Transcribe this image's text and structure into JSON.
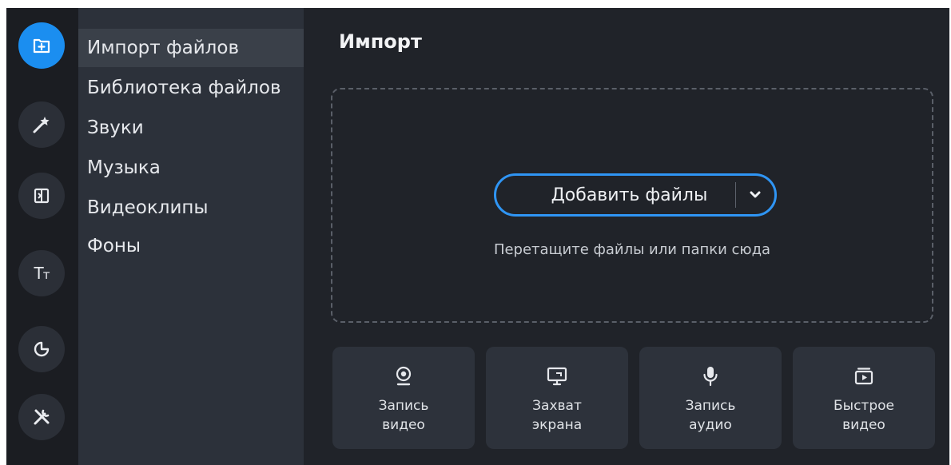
{
  "rail": {
    "items": [
      {
        "icon": "add-files-icon",
        "active": true
      },
      {
        "icon": "magic-wand-icon",
        "active": false
      },
      {
        "icon": "transitions-icon",
        "active": false
      },
      {
        "icon": "titles-icon",
        "glyph_big": "T",
        "glyph_small": "т",
        "active": false
      },
      {
        "icon": "stickers-icon",
        "active": false
      },
      {
        "icon": "tools-icon",
        "active": false
      }
    ],
    "accent_color": "#1b8ef0"
  },
  "categories": {
    "items": [
      {
        "label": "Импорт файлов",
        "active": true
      },
      {
        "label": "Библиотека файлов",
        "active": false
      },
      {
        "label": "Звуки",
        "active": false
      },
      {
        "label": "Музыка",
        "active": false
      },
      {
        "label": "Видеоклипы",
        "active": false
      },
      {
        "label": "Фоны",
        "active": false
      }
    ]
  },
  "main": {
    "title": "Импорт",
    "add_button": {
      "label": "Добавить файлы",
      "border_color": "#2f95f4"
    },
    "drop_hint": "Перетащите файлы или папки сюда",
    "tiles": [
      {
        "icon": "webcam-icon",
        "line1": "Запись",
        "line2": "видео"
      },
      {
        "icon": "screen-capture-icon",
        "line1": "Захват",
        "line2": "экрана"
      },
      {
        "icon": "microphone-icon",
        "line1": "Запись",
        "line2": "аудио"
      },
      {
        "icon": "quick-video-icon",
        "line1": "Быстрое",
        "line2": "видео"
      }
    ]
  }
}
